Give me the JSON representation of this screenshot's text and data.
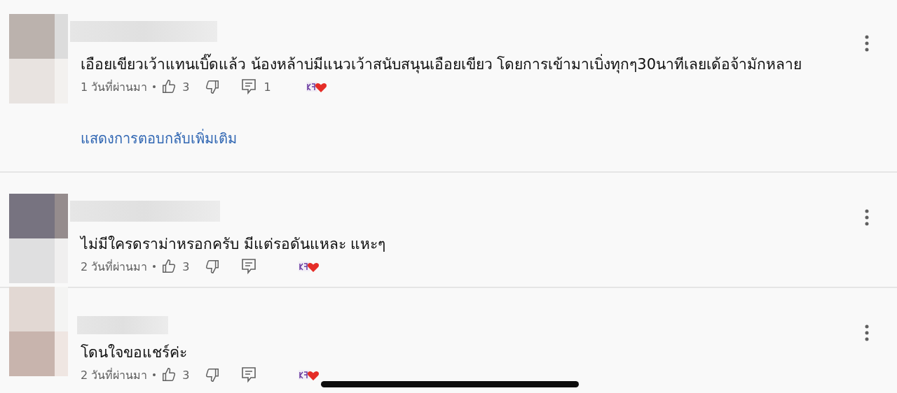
{
  "comments": [
    {
      "text": "เอือยเขียวเว้าแทนเบิ๊ดแล้ว น้องหล้าบ่มีแนวเว้าสนับสนุนเอือยเขียว โดยการเข้ามาเบิ่งทุกๆ30นาทีเลยเด้อจ้ามักหลาย",
      "time": "1 วันที่ผ่านมา",
      "likes": "3",
      "replies": "1",
      "hearted": true,
      "more_replies": "แสดงการตอบกลับเพิ่มเติม"
    },
    {
      "text": "ไม่มีใครดราม่าหรอกครับ  มีแต่รอดันแหละ แหะๆ",
      "time": "2 วันที่ผ่านมา",
      "likes": "3",
      "hearted": true
    },
    {
      "text": "โดนใจขอแชร์ค่ะ",
      "time": "2 วันที่ผ่านมา",
      "likes": "3",
      "hearted": true
    }
  ]
}
